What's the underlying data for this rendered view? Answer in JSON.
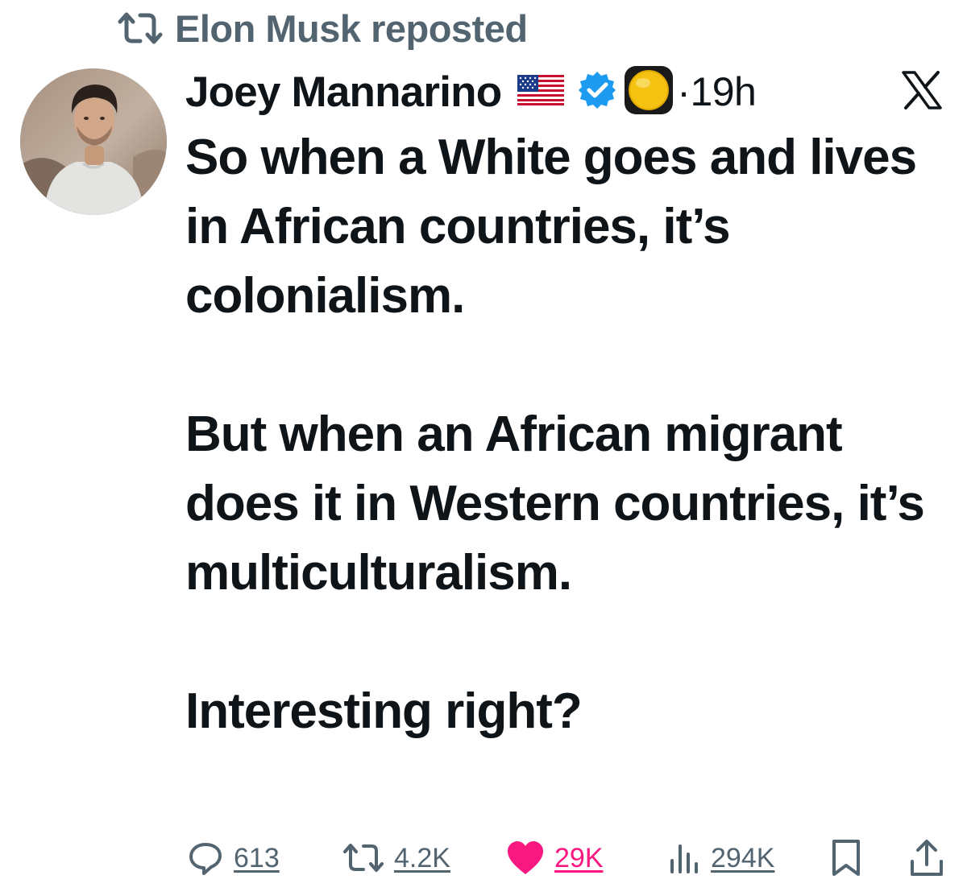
{
  "repost": {
    "icon": "repost-icon",
    "label": "Elon Musk reposted"
  },
  "author": {
    "avatar": "avatar",
    "name": "Joey Mannarino",
    "flag_icon": "us-flag-icon",
    "verified_icon": "verified-badge-icon",
    "badge_icon": "yellow-circle-emoji-icon",
    "separator": "·",
    "time": "19h"
  },
  "platform_icon": "x-logo-icon",
  "tweet": {
    "paragraphs": [
      "So when a White goes and lives in African countries, it’s colonialism.",
      "But when an African migrant does it in Western countries, it’s multiculturalism.",
      "Interesting right?"
    ]
  },
  "actions": {
    "reply": {
      "icon": "reply-icon",
      "count": "613"
    },
    "retweet": {
      "icon": "retweet-icon",
      "count": "4.2K"
    },
    "like": {
      "icon": "heart-icon",
      "count": "29K",
      "liked": true
    },
    "views": {
      "icon": "views-icon",
      "count": "294K"
    },
    "bookmark": {
      "icon": "bookmark-icon"
    },
    "share": {
      "icon": "share-icon"
    }
  },
  "colors": {
    "text": "#0f1419",
    "secondary": "#536471",
    "like": "#f91880",
    "verified": "#1d9bf0"
  }
}
